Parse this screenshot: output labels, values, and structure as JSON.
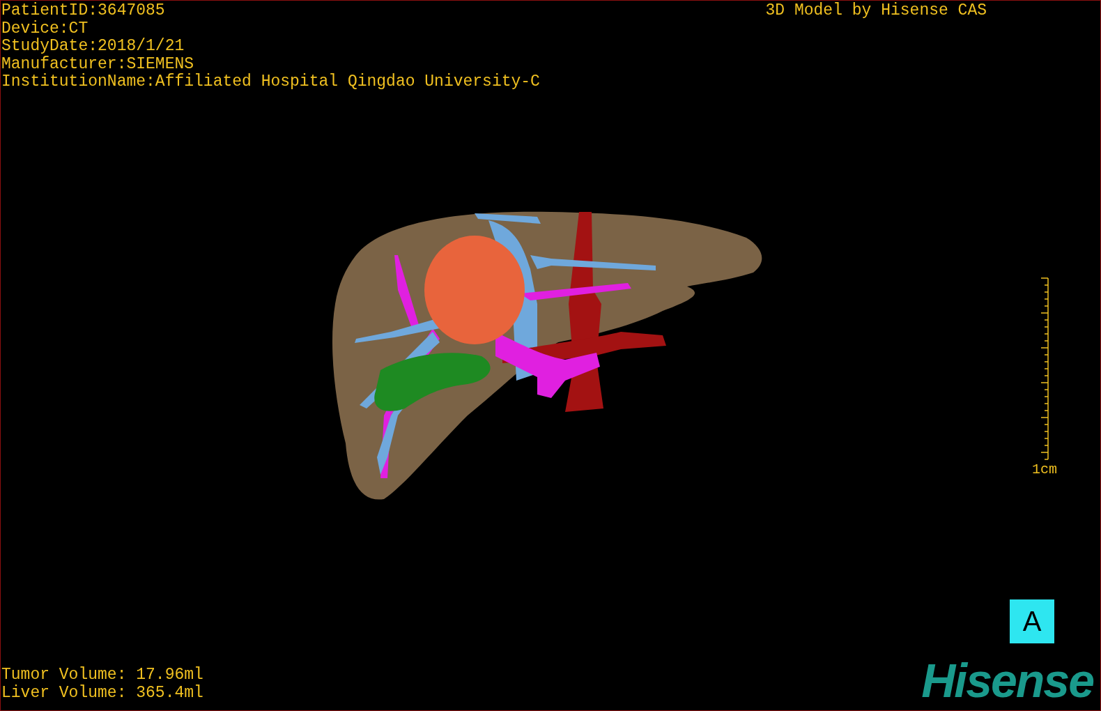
{
  "patient_info": [
    "PatientID:3647085",
    "Device:CT",
    "StudyDate:2018/1/21",
    "Manufacturer:SIEMENS",
    "InstitutionName:Affiliated Hospital Qingdao University-C"
  ],
  "title": "3D Model by Hisense CAS",
  "scale": {
    "label": "1cm"
  },
  "view_button": {
    "label": "A"
  },
  "volumes": [
    "Tumor Volume: 17.96ml",
    "Liver Volume: 365.4ml"
  ],
  "logo": "Hisense"
}
